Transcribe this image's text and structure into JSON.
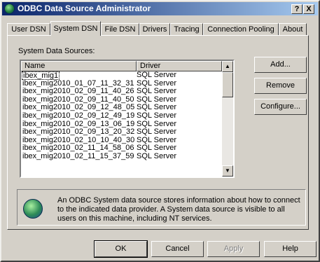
{
  "window": {
    "title": "ODBC Data Source Administrator",
    "help_button": "?",
    "close_button": "X"
  },
  "tabs": [
    {
      "label": "User DSN",
      "active": false
    },
    {
      "label": "System DSN",
      "active": true
    },
    {
      "label": "File DSN",
      "active": false
    },
    {
      "label": "Drivers",
      "active": false
    },
    {
      "label": "Tracing",
      "active": false
    },
    {
      "label": "Connection Pooling",
      "active": false
    },
    {
      "label": "About",
      "active": false
    }
  ],
  "system_dsn": {
    "section_label": "System Data Sources:",
    "columns": {
      "name": "Name",
      "driver": "Driver"
    },
    "rows": [
      {
        "name": "ibex_mig1",
        "driver": "SQL Server",
        "selected": true
      },
      {
        "name": "ibex_mig2010_01_07_11_32_31",
        "driver": "SQL Server"
      },
      {
        "name": "ibex_mig2010_02_09_11_40_26",
        "driver": "SQL Server"
      },
      {
        "name": "ibex_mig2010_02_09_11_40_50",
        "driver": "SQL Server"
      },
      {
        "name": "ibex_mig2010_02_09_12_48_05",
        "driver": "SQL Server"
      },
      {
        "name": "ibex_mig2010_02_09_12_49_19",
        "driver": "SQL Server"
      },
      {
        "name": "ibex_mig2010_02_09_13_06_19",
        "driver": "SQL Server"
      },
      {
        "name": "ibex_mig2010_02_09_13_20_32",
        "driver": "SQL Server"
      },
      {
        "name": "ibex_mig2010_02_10_10_40_30",
        "driver": "SQL Server"
      },
      {
        "name": "ibex_mig2010_02_11_14_58_06",
        "driver": "SQL Server"
      },
      {
        "name": "ibex_mig2010_02_11_15_37_59",
        "driver": "SQL Server"
      }
    ],
    "buttons": {
      "add": "Add...",
      "remove": "Remove",
      "configure": "Configure..."
    },
    "info_text": "An ODBC System data source stores information about how to connect to the indicated data provider.  A System data source is visible to all users on this machine, including NT services."
  },
  "footer": {
    "ok": "OK",
    "cancel": "Cancel",
    "apply": "Apply",
    "help": "Help"
  },
  "icons": {
    "title_icon": "odbc-globe-icon",
    "info_icon": "odbc-globe-icon",
    "scroll_up": "arrow-up-icon",
    "scroll_down": "arrow-down-icon"
  },
  "colors": {
    "titlebar_start": "#0a246a",
    "titlebar_end": "#a6caf0",
    "face": "#d4d0c8"
  }
}
